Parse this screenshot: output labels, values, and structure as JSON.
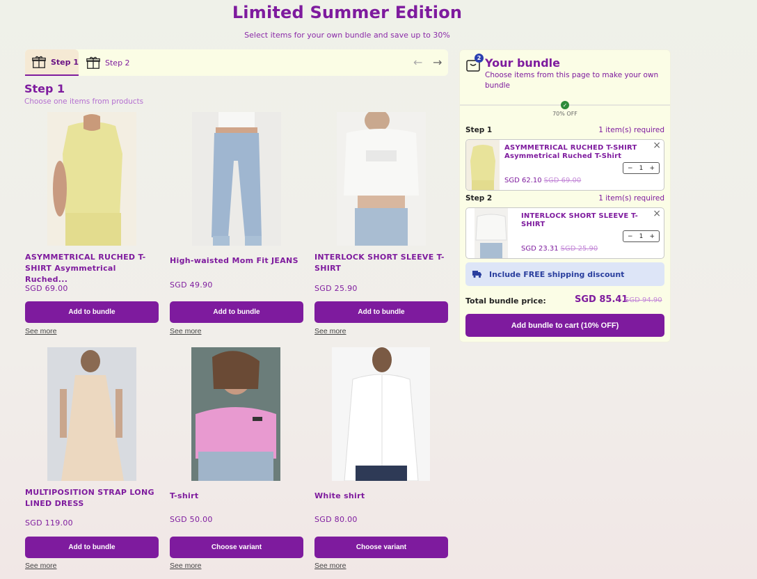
{
  "header": {
    "title": "Limited Summer Edition",
    "subtitle": "Select items for your own bundle and save up to 30%"
  },
  "tabs": [
    {
      "label": "Step 1",
      "icon": "gift-icon",
      "active": true
    },
    {
      "label": "Step 2",
      "icon": "gift-icon",
      "active": false
    }
  ],
  "nav": {
    "prev": "←",
    "next": "→"
  },
  "step": {
    "heading": "Step 1",
    "subheading": "Choose one items from products"
  },
  "products": [
    {
      "name": "ASYMMETRICAL RUCHED T-SHIRT Asymmetrical Ruched...",
      "price": "SGD 69.00",
      "button": "Add to bundle",
      "link": "See more"
    },
    {
      "name": "High-waisted Mom Fit JEANS",
      "price": "SGD 49.90",
      "button": "Add to bundle",
      "link": "See more"
    },
    {
      "name": "INTERLOCK SHORT SLEEVE T-SHIRT",
      "price": "SGD 25.90",
      "button": "Add to bundle",
      "link": "See more"
    },
    {
      "name": "MULTIPOSITION STRAP LONG LINED DRESS",
      "price": "SGD 119.00",
      "button": "Add to bundle",
      "link": "See more"
    },
    {
      "name": "T-shirt",
      "price": "SGD 50.00",
      "button": "Choose variant",
      "link": "See more"
    },
    {
      "name": "White shirt",
      "price": "SGD 80.00",
      "button": "Choose variant",
      "link": "See more"
    }
  ],
  "bundle": {
    "badge": "2",
    "title": "Your bundle",
    "description": "Choose items from this page to make your own bundle",
    "discount_label": "70% OFF",
    "check": "✓",
    "steps": [
      {
        "label": "Step 1",
        "requirement": "1 item(s) required",
        "item": {
          "name": "ASYMMETRICAL RUCHED T-SHIRT Asymmetrical Ruched T-Shirt",
          "price": "SGD 62.10",
          "old_price": "SGD 69.00",
          "qty": "1"
        }
      },
      {
        "label": "Step 2",
        "requirement": "1 item(s) required",
        "item": {
          "name": "INTERLOCK SHORT SLEEVE T-SHIRT",
          "price": "SGD 23.31",
          "old_price": "SGD 25.90",
          "qty": "1"
        }
      }
    ],
    "shipping": "Include FREE shipping discount",
    "total_label": "Total bundle price:",
    "total_price": "SGD 85.41",
    "total_old": "SGD 94.90",
    "cart_button": "Add bundle to cart (10% OFF)",
    "minus": "−",
    "plus": "+",
    "close": "×"
  },
  "colors": {
    "accent": "#7e1b9e",
    "shipping_bg": "#dde5f7",
    "panel_bg": "#fbfde6"
  }
}
